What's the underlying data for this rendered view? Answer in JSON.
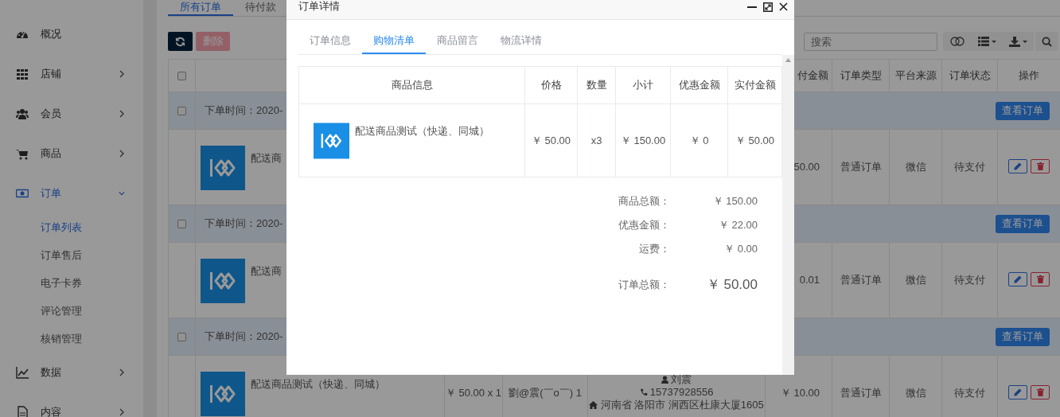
{
  "sidebar": {
    "items": [
      {
        "label": "概况",
        "kind": "link"
      },
      {
        "label": "店铺",
        "kind": "group",
        "expanded": false
      },
      {
        "label": "会员",
        "kind": "group",
        "expanded": false
      },
      {
        "label": "商品",
        "kind": "group",
        "expanded": false
      },
      {
        "label": "订单",
        "kind": "group",
        "expanded": true,
        "children": [
          {
            "label": "订单列表",
            "selected": true
          },
          {
            "label": "订单售后",
            "selected": false
          },
          {
            "label": "电子卡券",
            "selected": false
          },
          {
            "label": "评论管理",
            "selected": false
          },
          {
            "label": "核销管理",
            "selected": false
          }
        ]
      },
      {
        "label": "数据",
        "kind": "group",
        "expanded": false
      },
      {
        "label": "内容",
        "kind": "group",
        "expanded": false
      }
    ]
  },
  "page_tabs": [
    {
      "label": "所有订单",
      "selected": true
    },
    {
      "label": "待付款",
      "selected": false
    }
  ],
  "toolbar": {
    "delete_button": {
      "label": "删除",
      "disabled": true
    },
    "search": {
      "placeholder": "搜索"
    }
  },
  "orders_table": {
    "header_checked": false,
    "columns": [
      "付金额",
      "订单类型",
      "平台来源",
      "订单状态",
      "操作"
    ],
    "groups": [
      {
        "checked": false,
        "time": "下单时间：2020-",
        "view_button": "查看订单",
        "item": {
          "name": "配送商",
          "paid": "50.00",
          "type": "普通订单",
          "source": "微信",
          "status": "待支付"
        }
      },
      {
        "checked": false,
        "time": "下单时间：2020-",
        "view_button": "查看订单",
        "item": {
          "name": "配送商",
          "paid": "0.01",
          "type": "普通订单",
          "source": "微信",
          "status": "待支付"
        }
      },
      {
        "checked": false,
        "time": "下单时间：2020-",
        "view_button": "查看订单",
        "item": {
          "name": "配送商品测试（快递、同城）",
          "price_qty": "￥ 50.00 x 1",
          "buyer": "劉@震(￣o￣) 1",
          "receiver": "刘震",
          "phone": "15737928556",
          "address": "河南省 洛阳市 涧西区杜康大厦1605",
          "paid": "￥ 10.00",
          "type": "普通订单",
          "source": "微信",
          "status": "待支付"
        }
      }
    ]
  },
  "dialog": {
    "title": "订单详情",
    "tabs": [
      {
        "label": "订单信息",
        "selected": false
      },
      {
        "label": "购物清单",
        "selected": true
      },
      {
        "label": "商品留言",
        "selected": false
      },
      {
        "label": "物流详情",
        "selected": false
      }
    ],
    "columns": [
      "商品信息",
      "价格",
      "数量",
      "小计",
      "优惠金额",
      "实付金额"
    ],
    "rows": [
      {
        "name": "配送商品测试（快递、同城）",
        "price": "￥ 50.00",
        "quantity": "x3",
        "subtotal": "￥ 150.00",
        "discount": "￥ 0",
        "paid": "￥ 50.00"
      }
    ],
    "summary": [
      {
        "label": "商品总额：",
        "value": "￥ 150.00",
        "kind": "line"
      },
      {
        "label": "优惠金额：",
        "value": "￥ 22.00",
        "kind": "line"
      },
      {
        "label": "运费：",
        "value": "￥ 0.00",
        "kind": "line"
      },
      {
        "label": "订单总额：",
        "value": "￥ 50.00",
        "kind": "total"
      }
    ]
  }
}
